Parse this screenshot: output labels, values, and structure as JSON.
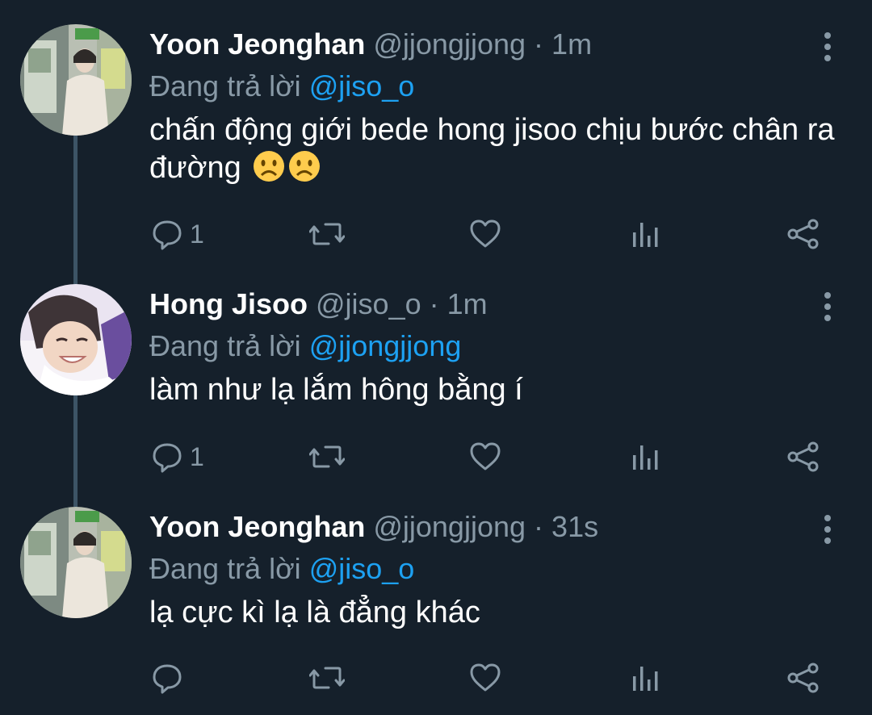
{
  "tweets": [
    {
      "name": "Yoon Jeonghan",
      "handle": "@jjongjjong",
      "separator": "·",
      "time": "1m",
      "reply_prefix": "Đang trả lời",
      "reply_to": "@jiso_o",
      "text": "chấn động giới bede hong jisoo chịu bước chân ra đường",
      "emojis": [
        "worried-face",
        "worried-face"
      ],
      "reply_count": "1",
      "retweet_count": "",
      "like_count": ""
    },
    {
      "name": "Hong Jisoo",
      "handle": "@jiso_o",
      "separator": "·",
      "time": "1m",
      "reply_prefix": "Đang trả lời",
      "reply_to": "@jjongjjong",
      "text": "làm như lạ lắm hông bằng í",
      "reply_count": "1",
      "retweet_count": "",
      "like_count": ""
    },
    {
      "name": "Yoon Jeonghan",
      "handle": "@jjongjjong",
      "separator": "·",
      "time": "31s",
      "reply_prefix": "Đang trả lời",
      "reply_to": "@jiso_o",
      "text": "lạ cực kì lạ là đẳng khác",
      "reply_count": "",
      "retweet_count": "",
      "like_count": ""
    }
  ],
  "colors": {
    "background": "#15202b",
    "primary_text": "#ffffff",
    "secondary_text": "#8899a6",
    "accent": "#1da1f2",
    "thread_line": "#3d5466"
  },
  "icons": [
    "reply-icon",
    "retweet-icon",
    "like-icon",
    "analytics-icon",
    "share-icon",
    "more-options-icon"
  ]
}
